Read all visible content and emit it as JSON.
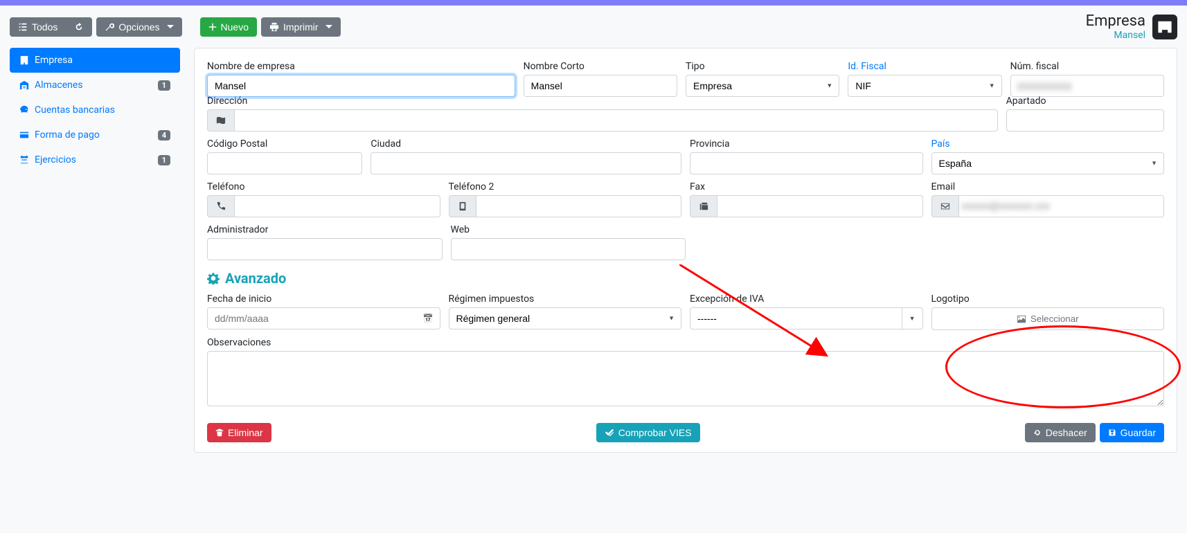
{
  "toolbar": {
    "todos": "Todos",
    "opciones": "Opciones",
    "nuevo": "Nuevo",
    "imprimir": "Imprimir"
  },
  "header": {
    "title": "Empresa",
    "subtitle": "Mansel"
  },
  "sidebar": {
    "items": [
      {
        "label": "Empresa",
        "badge": null,
        "active": true
      },
      {
        "label": "Almacenes",
        "badge": "1",
        "active": false
      },
      {
        "label": "Cuentas bancarias",
        "badge": null,
        "active": false
      },
      {
        "label": "Forma de pago",
        "badge": "4",
        "active": false
      },
      {
        "label": "Ejercicios",
        "badge": "1",
        "active": false
      }
    ]
  },
  "form": {
    "nombre_empresa": {
      "label": "Nombre de empresa",
      "value": "Mansel"
    },
    "nombre_corto": {
      "label": "Nombre Corto",
      "value": "Mansel"
    },
    "tipo": {
      "label": "Tipo",
      "value": "Empresa"
    },
    "id_fiscal": {
      "label": "Id. Fiscal",
      "value": "NIF"
    },
    "num_fiscal": {
      "label": "Núm. fiscal",
      "value": "XXXXXXXXX"
    },
    "direccion": {
      "label": "Dirección",
      "value": ""
    },
    "apartado": {
      "label": "Apartado",
      "value": ""
    },
    "codigo_postal": {
      "label": "Código Postal",
      "value": ""
    },
    "ciudad": {
      "label": "Ciudad",
      "value": ""
    },
    "provincia": {
      "label": "Provincia",
      "value": ""
    },
    "pais": {
      "label": "País",
      "value": "España"
    },
    "telefono": {
      "label": "Teléfono",
      "value": ""
    },
    "telefono2": {
      "label": "Teléfono 2",
      "value": ""
    },
    "fax": {
      "label": "Fax",
      "value": ""
    },
    "email": {
      "label": "Email",
      "value": "xxxxxx@xxxxxxx.xxx"
    },
    "administrador": {
      "label": "Administrador",
      "value": ""
    },
    "web": {
      "label": "Web",
      "value": ""
    }
  },
  "advanced": {
    "title": "Avanzado",
    "fecha_inicio": {
      "label": "Fecha de inicio",
      "placeholder": "dd/mm/aaaa"
    },
    "regimen": {
      "label": "Régimen impuestos",
      "value": "Régimen general"
    },
    "excepcion_iva": {
      "label": "Excepción de IVA",
      "value": "------"
    },
    "logotipo": {
      "label": "Logotipo",
      "button": "Seleccionar"
    },
    "observaciones": {
      "label": "Observaciones",
      "value": ""
    }
  },
  "footer": {
    "eliminar": "Eliminar",
    "comprobar_vies": "Comprobar VIES",
    "deshacer": "Deshacer",
    "guardar": "Guardar"
  }
}
